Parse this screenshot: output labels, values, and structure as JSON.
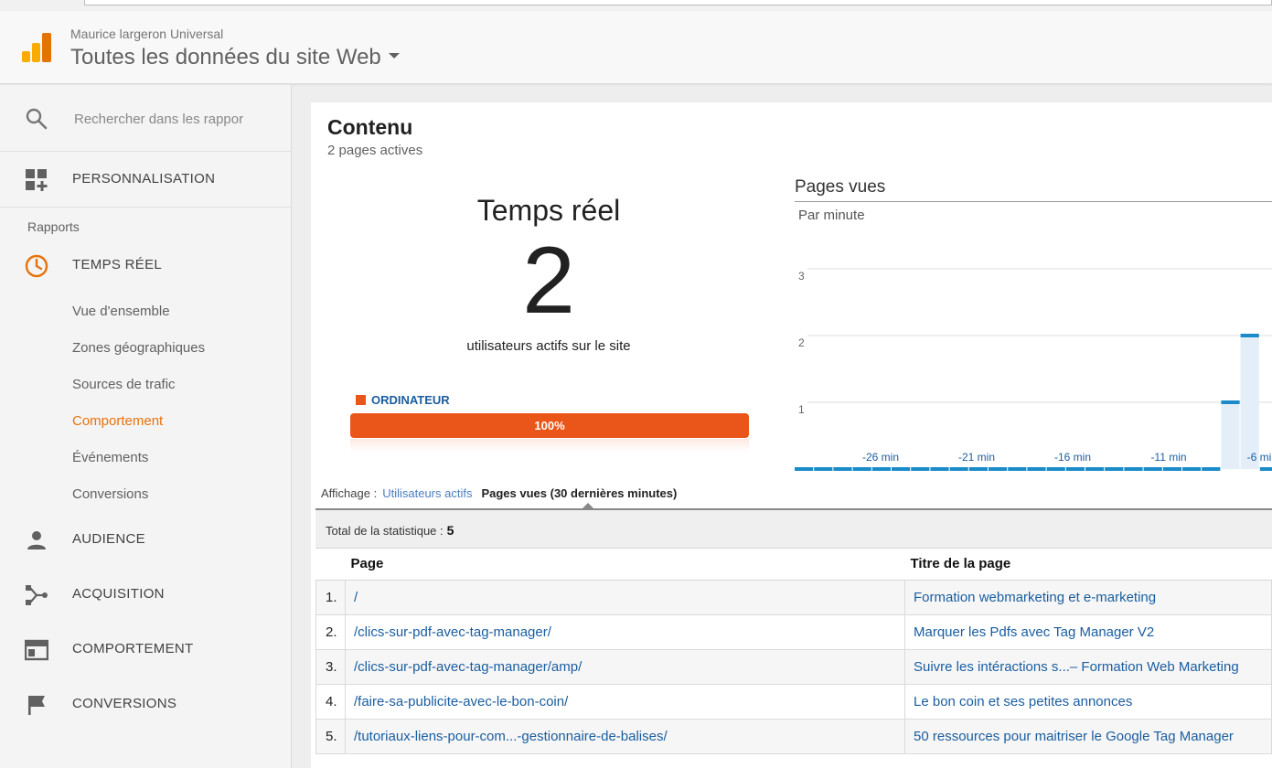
{
  "header": {
    "account": "Maurice largeron Universal",
    "property": "Toutes les données du site Web"
  },
  "sidebar": {
    "search_placeholder": "Rechercher dans les rappor",
    "customization": "PERSONNALISATION",
    "section_label": "Rapports",
    "realtime": "TEMPS RÉEL",
    "realtime_items": [
      "Vue d'ensemble",
      "Zones géographiques",
      "Sources de trafic",
      "Comportement",
      "Événements",
      "Conversions"
    ],
    "active_item": "Comportement",
    "audience": "AUDIENCE",
    "acquisition": "ACQUISITION",
    "behavior": "COMPORTEMENT",
    "conversions": "CONVERSIONS",
    "accent_color": "#e8710a"
  },
  "main": {
    "title": "Contenu",
    "subtitle": "2 pages actives",
    "realtime_title": "Temps réel",
    "active_users": "2",
    "active_users_caption": "utilisateurs actifs sur le site",
    "device_label": "ORDINATEUR",
    "device_percent_label": "100%",
    "device_percent": 100,
    "pageviews_title": "Pages vues",
    "pageviews_subtitle": "Par minute",
    "display_label": "Affichage :",
    "display_link": "Utilisateurs actifs",
    "display_current": "Pages vues (30 dernières minutes)",
    "total_label": "Total de la statistique :",
    "total_value": "5",
    "table": {
      "headers": [
        "Page",
        "Titre de la page"
      ],
      "rows": [
        {
          "num": "1.",
          "page": "/",
          "title": "Formation webmarketing et e-marketing"
        },
        {
          "num": "2.",
          "page": "/clics-sur-pdf-avec-tag-manager/",
          "title": "Marquer les Pdfs avec Tag Manager V2"
        },
        {
          "num": "3.",
          "page": "/clics-sur-pdf-avec-tag-manager/amp/",
          "title": "Suivre les intéractions s...– Formation Web Marketing"
        },
        {
          "num": "4.",
          "page": "/faire-sa-publicite-avec-le-bon-coin/",
          "title": "Le bon coin et ses petites annonces"
        },
        {
          "num": "5.",
          "page": "/tutoriaux-liens-pour-com...-gestionnaire-de-balises/",
          "title": "50 ressources pour maitriser le Google Tag Manager"
        }
      ]
    }
  },
  "chart_data": {
    "type": "bar",
    "title": "Pages vues",
    "subtitle": "Par minute",
    "yticks": [
      "1",
      "2",
      "3"
    ],
    "ylim": [
      0,
      3
    ],
    "xticks": [
      "-26 min",
      "-21 min",
      "-16 min",
      "-11 min",
      "-6 mi"
    ],
    "x": [
      -30,
      -29,
      -28,
      -27,
      -26,
      -25,
      -24,
      -23,
      -22,
      -21,
      -20,
      -19,
      -18,
      -17,
      -16,
      -15,
      -14,
      -13,
      -12,
      -11,
      -10,
      -9,
      -8,
      -7,
      -6,
      -5
    ],
    "values": [
      0,
      0,
      0,
      0,
      0,
      0,
      0,
      0,
      0,
      0,
      0,
      0,
      0,
      0,
      0,
      0,
      0,
      0,
      0,
      0,
      0,
      0,
      1,
      2,
      0,
      0
    ],
    "series_color": "#1a8bc8"
  }
}
